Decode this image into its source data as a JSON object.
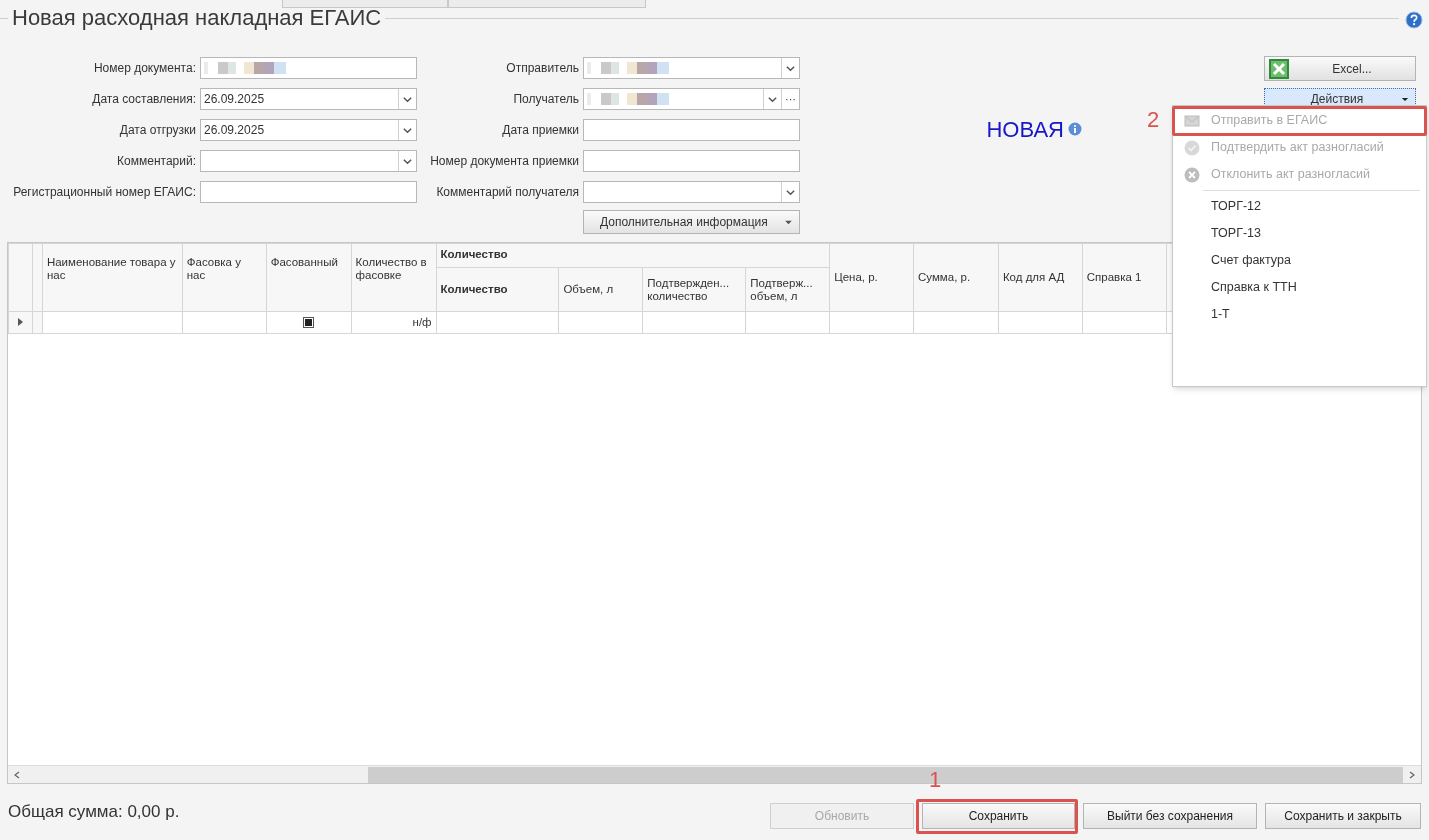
{
  "title": "Новая расходная накладная ЕГАИС",
  "form_left": [
    {
      "label": "Номер документа:",
      "redacted": true,
      "dropdown": false
    },
    {
      "label": "Дата составления:",
      "value": "26.09.2025",
      "dropdown": true
    },
    {
      "label": "Дата отгрузки",
      "value": "26.09.2025",
      "dropdown": true
    },
    {
      "label": "Комментарий:",
      "dropdown": true
    },
    {
      "label": "Регистрационный номер ЕГАИС:",
      "dropdown": false
    }
  ],
  "form_right": [
    {
      "label": "Отправитель",
      "redacted": true,
      "dropdown": true
    },
    {
      "label": "Получатель",
      "redacted": true,
      "dropdown": true,
      "more_button": "···"
    },
    {
      "label": "Дата приемки",
      "dropdown": false
    },
    {
      "label": "Номер документа приемки",
      "dropdown": false
    },
    {
      "label": "Комментарий получателя",
      "dropdown": true
    }
  ],
  "extra_button": "Дополнительная информация",
  "status": "НОВАЯ",
  "excel_button": "Excel...",
  "actions_button": {
    "label": "Действия",
    "selected": true
  },
  "actions_menu": [
    {
      "label": "Отправить в ЕГАИС",
      "kind": "send",
      "disabled": true
    },
    {
      "label": "Подтвердить акт разногласий",
      "kind": "confirm",
      "disabled": true
    },
    {
      "label": "Отклонить акт разногласий",
      "kind": "reject",
      "disabled": true
    },
    {
      "label": "ТОРГ-12",
      "kind": "plain",
      "disabled": false,
      "separator_before": true
    },
    {
      "label": "ТОРГ-13",
      "kind": "plain",
      "disabled": false
    },
    {
      "label": "Счет фактура",
      "kind": "plain",
      "disabled": false
    },
    {
      "label": "Справка к ТТН",
      "kind": "plain",
      "disabled": false
    },
    {
      "label": "1-Т",
      "kind": "plain",
      "disabled": false
    }
  ],
  "table": {
    "columns": [
      {
        "kind": "single",
        "label": "Наименование товара у нас"
      },
      {
        "kind": "single",
        "label": "Фасовка у нас"
      },
      {
        "kind": "single",
        "label": "Фасованный"
      },
      {
        "kind": "single",
        "label": "Количество в фасовке"
      },
      {
        "kind": "group",
        "label": "Количество",
        "children": [
          {
            "label": "Количество",
            "bold": true
          },
          {
            "label": "Объем, л",
            "bold": false
          },
          {
            "label": "Подтвержден... количество",
            "bold": false
          },
          {
            "label": "Подтверж... объем, л",
            "bold": false
          }
        ]
      },
      {
        "kind": "single",
        "label": "Цена, р."
      },
      {
        "kind": "single",
        "label": "Сумма, р."
      },
      {
        "kind": "single",
        "label": "Код для АД"
      },
      {
        "kind": "single",
        "label": "Справка 1"
      }
    ],
    "rows": [
      {
        "current": true,
        "cells": [
          null,
          null,
          {
            "kind": "checkbox",
            "checked": true
          },
          {
            "kind": "text",
            "text": "н/ф"
          },
          null,
          null,
          null,
          null,
          null,
          null,
          null,
          null
        ]
      }
    ]
  },
  "total": "Общая сумма: 0,00 р.",
  "footer_buttons": [
    {
      "label": "Обновить",
      "disabled": true
    },
    {
      "label": "Сохранить",
      "disabled": false
    },
    {
      "label": "Выйти без сохранения",
      "disabled": false
    },
    {
      "label": "Сохранить и закрыть",
      "disabled": false
    }
  ],
  "callouts": [
    "2",
    "1"
  ]
}
